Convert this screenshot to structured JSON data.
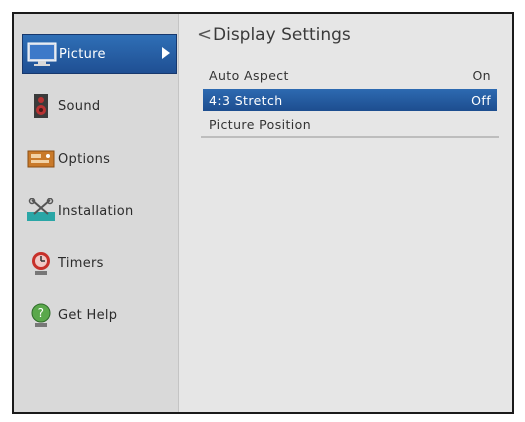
{
  "sidebar": {
    "items": [
      {
        "label": "Picture",
        "icon": "tv-icon",
        "active": true
      },
      {
        "label": "Sound",
        "icon": "speaker-icon"
      },
      {
        "label": "Options",
        "icon": "options-icon"
      },
      {
        "label": "Installation",
        "icon": "tools-icon"
      },
      {
        "label": "Timers",
        "icon": "timer-icon"
      },
      {
        "label": "Get Help",
        "icon": "help-icon"
      }
    ]
  },
  "main": {
    "title": "Display Settings",
    "back_glyph": "<",
    "rows": [
      {
        "label": "Auto Aspect",
        "value": "On"
      },
      {
        "label": "4:3 Stretch",
        "value": "Off",
        "selected": true
      },
      {
        "label": "Picture Position",
        "value": ""
      }
    ]
  },
  "colors": {
    "accent": "#2f6fb6",
    "background": "#e6e6e6"
  }
}
